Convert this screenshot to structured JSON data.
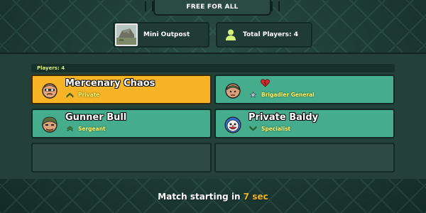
{
  "header": {
    "mode": "FREE FOR ALL"
  },
  "info": {
    "map_name": "Mini Outpost",
    "total_players_label": "Total Players:",
    "total_players_count": "4",
    "map_icon": "map-thumbnail",
    "players_icon": "person-icon"
  },
  "players_panel": {
    "label": "Players: 4"
  },
  "players": [
    {
      "name": "Mercenary Chaos",
      "rank": "Private",
      "rank_icon": "private-chevron-icon",
      "highlighted": true
    },
    {
      "name": "",
      "rank": "Brigadier General",
      "rank_icon": "star-icon",
      "status_icon": "broken-heart-icon"
    },
    {
      "name": "Gunner Bull",
      "rank": "Sergeant",
      "rank_icon": "sergeant-chevron-icon"
    },
    {
      "name": "Private Baldy",
      "rank": "Specialist",
      "rank_icon": "specialist-chevron-icon"
    }
  ],
  "footer": {
    "prefix": "Match starting in",
    "seconds": "7 sec"
  },
  "colors": {
    "highlight": "#f7b426",
    "slot": "#45ad8b",
    "empty_slot": "#2d4b44",
    "rank_text": "#fff06a",
    "timer": "#f2b71f"
  }
}
